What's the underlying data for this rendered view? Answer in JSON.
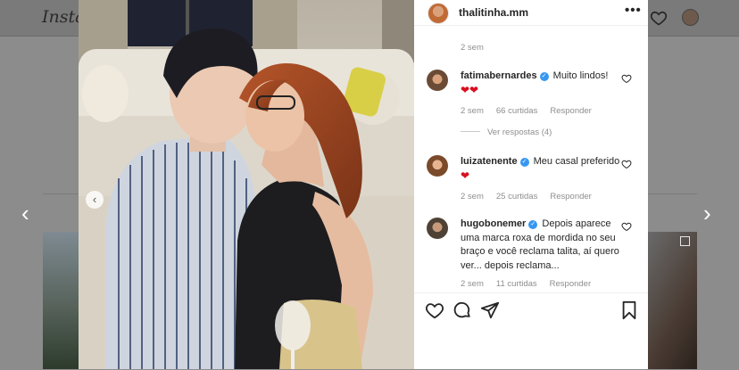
{
  "app": {
    "logo_text": "Insta"
  },
  "header": {
    "heart_icon": "heart-icon",
    "profile_icon": "avatar"
  },
  "navigation": {
    "prev_arrow": "‹",
    "next_arrow": "›",
    "photo_prev": "‹"
  },
  "post": {
    "username": "thalitinha.mm",
    "more_label": "•••",
    "caption_time": "2 sem",
    "comments": [
      {
        "username": "fatimabernardes",
        "verified": true,
        "text": "Muito lindos!",
        "emoji": "❤❤",
        "time": "2 sem",
        "likes": "66 curtidas",
        "reply_label": "Responder",
        "view_replies": "Ver respostas (4)"
      },
      {
        "username": "luizatenente",
        "verified": true,
        "text": "Meu casal preferido",
        "emoji": "❤",
        "time": "2 sem",
        "likes": "25 curtidas",
        "reply_label": "Responder"
      },
      {
        "username": "hugobonemer",
        "verified": true,
        "text": "Depois aparece uma marca roxa de mordida no seu braço e você reclama talita, aí quero ver... depois reclama...",
        "time": "2 sem",
        "likes": "11 curtidas",
        "reply_label": "Responder"
      }
    ]
  },
  "colors": {
    "verified": "#3897f0",
    "heart_red": "#d90f1f",
    "text_primary": "#262626",
    "text_secondary": "#8e8e8e"
  }
}
